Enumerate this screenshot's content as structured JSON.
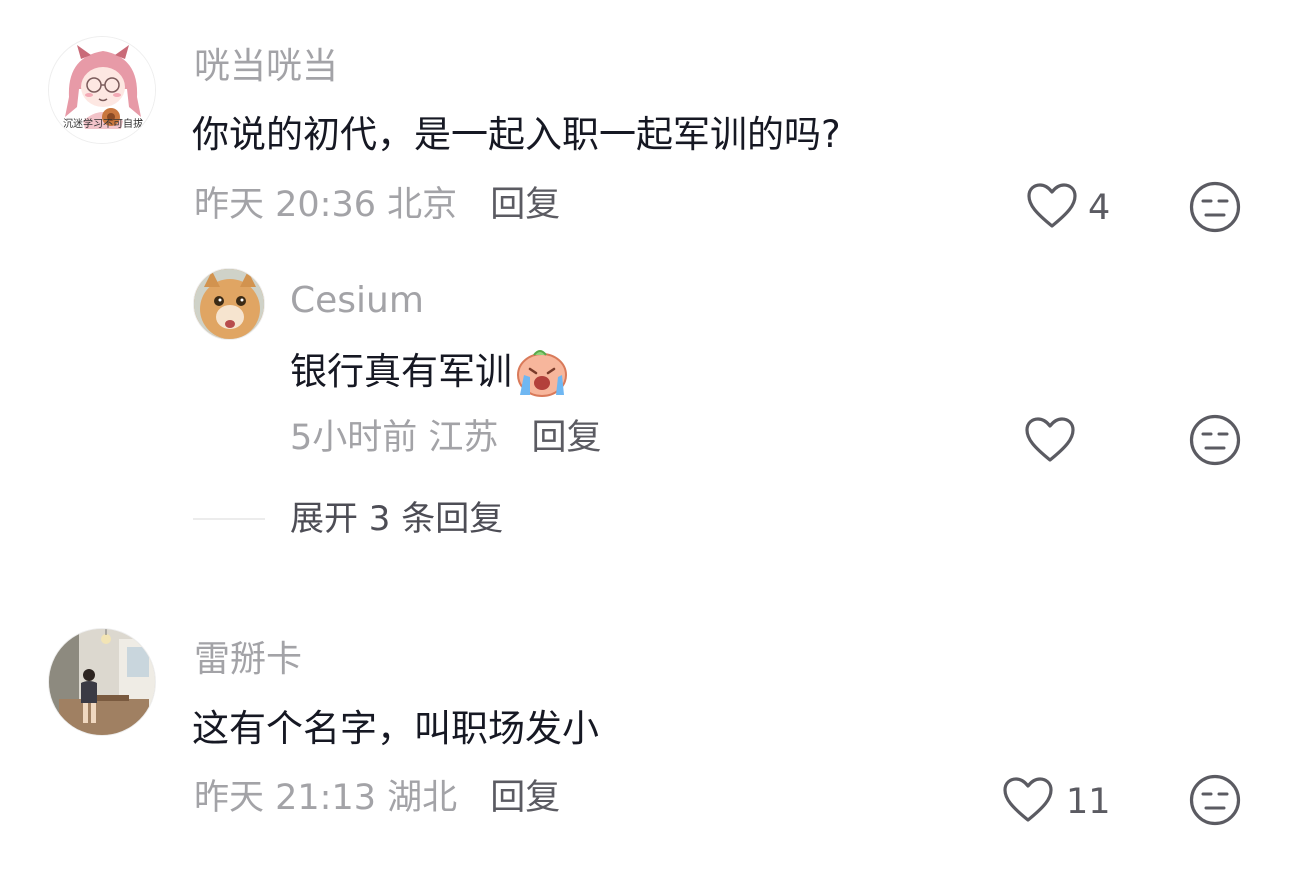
{
  "comments": [
    {
      "username": "咣当咣当",
      "avatar_caption": "沉迷学习不可自拔",
      "text": "你说的初代，是一起入职一起军训的吗?",
      "time": "昨天 20:36",
      "location": "北京",
      "reply_label": "回复",
      "like_count": "4",
      "replies": [
        {
          "username": "Cesium",
          "text": "银行真有军训",
          "emoji": "crying-face-sticker",
          "time": "5小时前",
          "location": "江苏",
          "reply_label": "回复",
          "like_count": ""
        }
      ],
      "expand_label": "展开 3 条回复"
    },
    {
      "username": "雷掰卡",
      "text": "这有个名字，叫职场发小",
      "time": "昨天 21:13",
      "location": "湖北",
      "reply_label": "回复",
      "like_count": "11"
    }
  ],
  "icons": {
    "like": "heart-outline-icon",
    "dislike": "meh-face-icon"
  },
  "colors": {
    "username": "#a3a3a7",
    "content": "#161823",
    "reply": "#5b5b62",
    "icon_stroke": "#5b5b62"
  }
}
